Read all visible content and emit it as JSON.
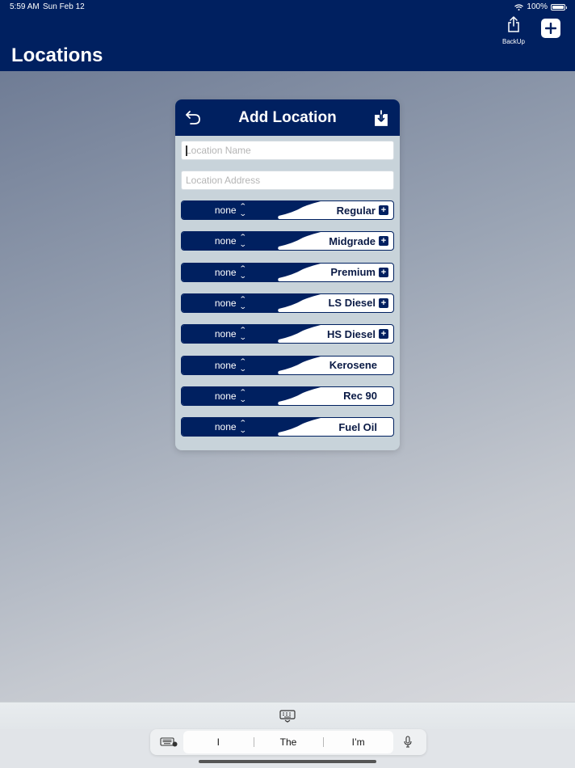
{
  "status": {
    "time": "5:59 AM",
    "date": "Sun Feb 12",
    "battery": "100%",
    "battery_level": 1.0
  },
  "nav": {
    "title": "Locations",
    "backup_label": "BackUp",
    "share_icon": "share-icon",
    "add_icon": "plus-icon"
  },
  "dialog": {
    "title": "Add Location",
    "back_icon": "undo-arrow-icon",
    "save_icon": "download-tray-icon",
    "name_placeholder": "Location Name",
    "address_placeholder": "Location Address",
    "fuels": [
      {
        "selection": "none",
        "name": "Regular",
        "has_add": true
      },
      {
        "selection": "none",
        "name": "Midgrade",
        "has_add": true
      },
      {
        "selection": "none",
        "name": "Premium",
        "has_add": true
      },
      {
        "selection": "none",
        "name": "LS Diesel",
        "has_add": true
      },
      {
        "selection": "none",
        "name": "HS Diesel",
        "has_add": true
      },
      {
        "selection": "none",
        "name": "Kerosene",
        "has_add": false
      },
      {
        "selection": "none",
        "name": "Rec 90",
        "has_add": false
      },
      {
        "selection": "none",
        "name": "Fuel Oil",
        "has_add": false
      }
    ]
  },
  "keyboard": {
    "suggestions": [
      "I",
      "The",
      "I’m"
    ],
    "icons": [
      "keyboard-hide-icon",
      "keyboard-switch-icon",
      "microphone-icon"
    ]
  },
  "colors": {
    "navy": "#002060",
    "card": "#c8d3da"
  }
}
